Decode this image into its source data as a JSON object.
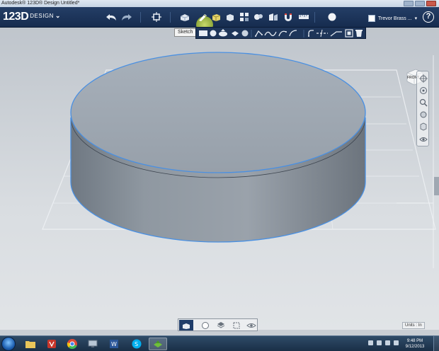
{
  "window": {
    "title": "Autodesk® 123D® Design Untitled*"
  },
  "app": {
    "logo_number": "123D",
    "logo_word": "DESIGN",
    "user_name": "Trevor Brass ...",
    "help_label": "?"
  },
  "toolbar": {
    "tooltip": "Sketch",
    "active_tool": "sketch"
  },
  "viewcube": {
    "label": "FRONT"
  },
  "status": {
    "units": "Units : In"
  },
  "taskbar": {
    "time": "9:48 PM",
    "date": "9/12/2013"
  },
  "colors": {
    "toolbar_bg": "#1c345a",
    "selection_outline": "#4a90e2",
    "sketch_highlight": "#9fb845",
    "viewport_bg": "#cfd4d9"
  }
}
